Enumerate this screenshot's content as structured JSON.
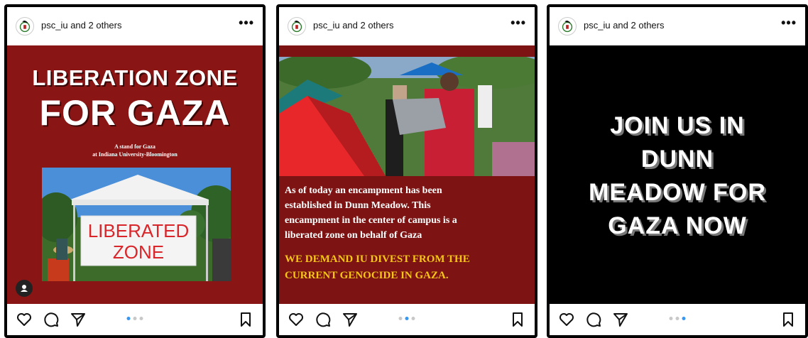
{
  "posts": [
    {
      "header": {
        "username": "psc_iu",
        "others": "and 2 others",
        "more_label": "•••"
      },
      "slides": {
        "count": 3,
        "active_index": 0
      },
      "content": {
        "title_line1": "LIBERATION ZONE",
        "title_line2": "FOR GAZA",
        "subtitle_line1": "A stand for Gaza",
        "subtitle_line2": "at Indiana University-Bloomington",
        "banner_line1": "LIBERATED",
        "banner_line2": "ZONE",
        "background_color": "#8a1515"
      }
    },
    {
      "header": {
        "username": "psc_iu",
        "others": "and 2 others",
        "more_label": "•••"
      },
      "slides": {
        "count": 3,
        "active_index": 1
      },
      "content": {
        "body_line1": "As of today an encampment has been",
        "body_line2": "established in Dunn Meadow. This",
        "body_line3": "encampment in the center of campus is a",
        "body_line4": "liberated zone on behalf of Gaza",
        "demand_line1": "WE DEMAND IU DIVEST FROM THE",
        "demand_line2": "CURRENT GENOCIDE IN GAZA.",
        "demand_color": "#f5c518",
        "background_color": "#7d1313"
      }
    },
    {
      "header": {
        "username": "psc_iu",
        "others": "and 2 others",
        "more_label": "•••"
      },
      "slides": {
        "count": 3,
        "active_index": 2
      },
      "content": {
        "line1": "JOIN US IN",
        "line2": "DUNN",
        "line3": "MEADOW FOR",
        "line4": "GAZA NOW",
        "background_color": "#000000"
      }
    }
  ],
  "icons": {
    "like": "heart-icon",
    "comment": "comment-icon",
    "share": "send-icon",
    "save": "bookmark-icon",
    "user_tag": "user-tag-icon"
  },
  "colors": {
    "dot_active": "#3897f0",
    "dot_inactive": "#c8c8c8"
  }
}
